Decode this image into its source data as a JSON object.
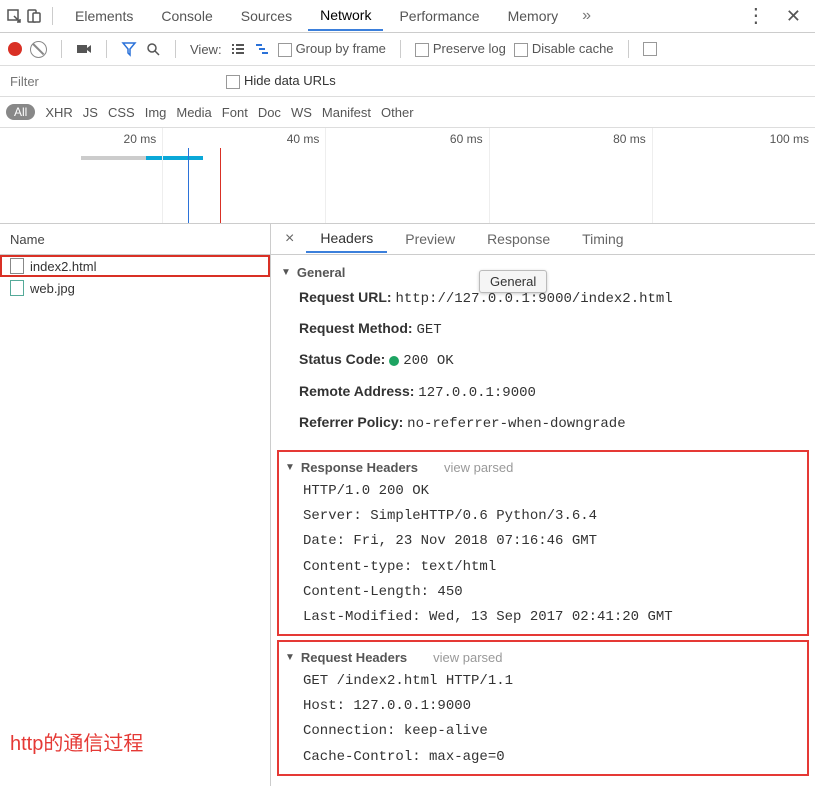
{
  "topTabs": {
    "t0": "Elements",
    "t1": "Console",
    "t2": "Sources",
    "t3": "Network",
    "t4": "Performance",
    "t5": "Memory"
  },
  "row2": {
    "view": "View:",
    "groupByFrame": "Group by frame",
    "preserveLog": "Preserve log",
    "disableCache": "Disable cache"
  },
  "row3": {
    "filterPh": "Filter",
    "hideDataUrls": "Hide data URLs"
  },
  "filterTypes": {
    "all": "All",
    "xhr": "XHR",
    "js": "JS",
    "css": "CSS",
    "img": "Img",
    "media": "Media",
    "font": "Font",
    "doc": "Doc",
    "ws": "WS",
    "manifest": "Manifest",
    "other": "Other"
  },
  "wf": {
    "t1": "20 ms",
    "t2": "40 ms",
    "t3": "60 ms",
    "t4": "80 ms",
    "t5": "100 ms"
  },
  "nameHdr": "Name",
  "files": {
    "f0": "index2.html",
    "f1": "web.jpg"
  },
  "annotation": "http的通信过程",
  "detailTabs": {
    "headers": "Headers",
    "preview": "Preview",
    "response": "Response",
    "timing": "Timing"
  },
  "tooltip": "General",
  "sections": {
    "general": "General",
    "responseHeaders": "Response Headers",
    "requestHeaders": "Request Headers",
    "viewParsed": "view parsed"
  },
  "general": {
    "urlK": "Request URL:",
    "urlV": "http://127.0.0.1:9000/index2.html",
    "methodK": "Request Method:",
    "methodV": "GET",
    "statusK": "Status Code:",
    "statusV": "200 OK",
    "remoteK": "Remote Address:",
    "remoteV": "127.0.0.1:9000",
    "refK": "Referrer Policy:",
    "refV": "no-referrer-when-downgrade"
  },
  "respRaw": {
    "l0": "HTTP/1.0 200 OK",
    "l1": "Server: SimpleHTTP/0.6 Python/3.6.4",
    "l2": "Date: Fri, 23 Nov 2018 07:16:46 GMT",
    "l3": "Content-type: text/html",
    "l4": "Content-Length: 450",
    "l5": "Last-Modified: Wed, 13 Sep 2017 02:41:20 GMT"
  },
  "reqRaw": {
    "l0": "GET /index2.html HTTP/1.1",
    "l1": "Host: 127.0.0.1:9000",
    "l2": "Connection: keep-alive",
    "l3": "Cache-Control: max-age=0"
  }
}
